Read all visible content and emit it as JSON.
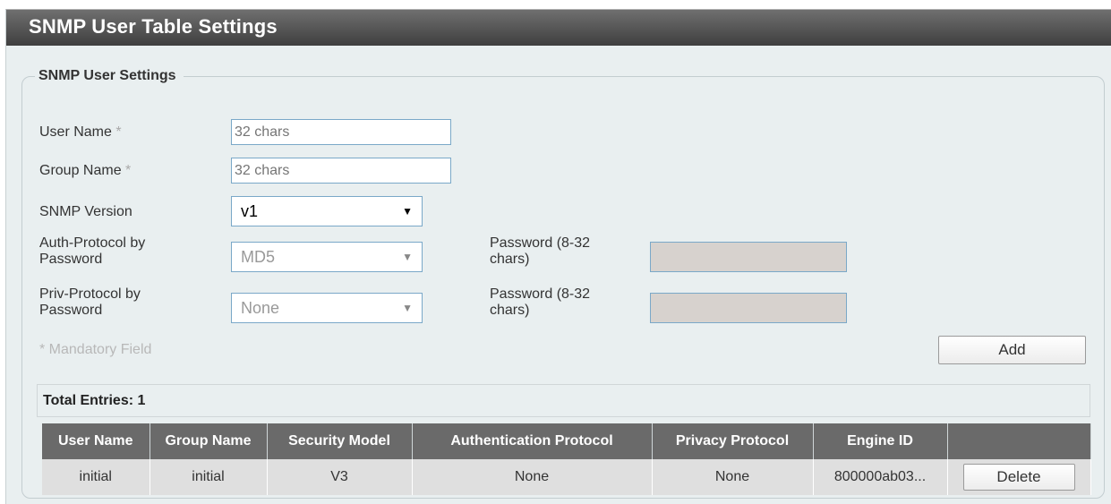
{
  "page": {
    "title": "SNMP User Table Settings"
  },
  "form": {
    "legend": "SNMP User Settings",
    "user_name": {
      "label": "User Name",
      "required_mark": "*",
      "placeholder": "32 chars"
    },
    "group_name": {
      "label": "Group Name",
      "required_mark": "*",
      "placeholder": "32 chars"
    },
    "snmp_version": {
      "label": "SNMP Version",
      "value": "v1"
    },
    "auth_protocol": {
      "label_line1": "Auth-Protocol by",
      "label_line2": "Password",
      "value": "MD5",
      "password_label_line1": "Password (8-32",
      "password_label_line2": "chars)"
    },
    "priv_protocol": {
      "label_line1": "Priv-Protocol by",
      "label_line2": "Password",
      "value": "None",
      "password_label_line1": "Password (8-32",
      "password_label_line2": "chars)"
    },
    "mandatory_note": "* Mandatory Field",
    "add_label": "Add"
  },
  "table": {
    "total_label": "Total Entries: 1",
    "columns": [
      "User Name",
      "Group Name",
      "Security Model",
      "Authentication Protocol",
      "Privacy Protocol",
      "Engine ID",
      ""
    ],
    "rows": [
      {
        "user_name": "initial",
        "group_name": "initial",
        "security_model": "V3",
        "auth_protocol": "None",
        "privacy_protocol": "None",
        "engine_id": "800000ab03...",
        "action": "Delete"
      }
    ]
  },
  "colors": {
    "panel_bg": "#e9eff0",
    "title_bar": "#4f4f4f",
    "header_bg": "#6a6a6a",
    "row_bg": "#dfdfdf",
    "disabled_field": "#d7d2ce",
    "input_border": "#7aa8c8"
  },
  "icons": {
    "dropdown": "caret-down-icon"
  }
}
